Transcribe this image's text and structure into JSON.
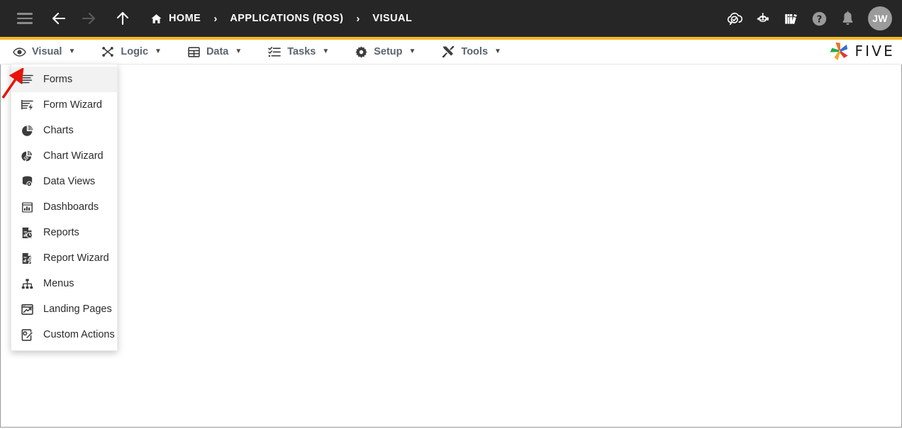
{
  "header": {
    "menu_icon": "hamburger-icon",
    "back_icon": "arrow-left-icon",
    "forward_icon": "arrow-right-icon",
    "up_icon": "arrow-up-icon",
    "breadcrumbs": [
      {
        "label": "HOME",
        "icon": "home-icon"
      },
      {
        "label": "APPLICATIONS (ROS)",
        "icon": ""
      },
      {
        "label": "VISUAL",
        "icon": ""
      }
    ],
    "separator": "›",
    "actions": [
      {
        "name": "cloud-search-icon",
        "title": ""
      },
      {
        "name": "chat-bot-icon",
        "title": ""
      },
      {
        "name": "library-books-icon",
        "title": ""
      },
      {
        "name": "help-circle-icon",
        "title": ""
      },
      {
        "name": "bell-icon",
        "title": ""
      }
    ],
    "avatar_initials": "JW",
    "accent_color": "#f5b826",
    "background_color": "#262626"
  },
  "menubar": {
    "items": [
      {
        "label": "Visual",
        "icon": "eye-icon",
        "caret": "▼",
        "open": true
      },
      {
        "label": "Logic",
        "icon": "logic-nodes-icon",
        "caret": "▼",
        "open": false
      },
      {
        "label": "Data",
        "icon": "table-grid-icon",
        "caret": "▼",
        "open": false
      },
      {
        "label": "Tasks",
        "icon": "checklist-icon",
        "caret": "▼",
        "open": false
      },
      {
        "label": "Setup",
        "icon": "gear-icon",
        "caret": "▼",
        "open": false
      },
      {
        "label": "Tools",
        "icon": "tools-wrench-screwdriver-icon",
        "caret": "▼",
        "open": false
      }
    ],
    "brand": {
      "wordmark": "FIVE",
      "logo_icon": "five-pinwheel-logo",
      "logo_colors": [
        "#2d6fd6",
        "#e03b2e",
        "#f0a81e",
        "#2aa84a"
      ]
    }
  },
  "visual_menu": {
    "items": [
      {
        "label": "Forms",
        "icon": "form-lines-icon",
        "active": true
      },
      {
        "label": "Form Wizard",
        "icon": "form-wizard-icon",
        "active": false
      },
      {
        "label": "Charts",
        "icon": "pie-chart-icon",
        "active": false
      },
      {
        "label": "Chart Wizard",
        "icon": "chart-wizard-icon",
        "active": false
      },
      {
        "label": "Data Views",
        "icon": "database-view-icon",
        "active": false
      },
      {
        "label": "Dashboards",
        "icon": "dashboard-icon",
        "active": false
      },
      {
        "label": "Reports",
        "icon": "report-icon",
        "active": false
      },
      {
        "label": "Report Wizard",
        "icon": "report-wizard-icon",
        "active": false
      },
      {
        "label": "Menus",
        "icon": "sitemap-icon",
        "active": false
      },
      {
        "label": "Landing Pages",
        "icon": "landing-page-icon",
        "active": false
      },
      {
        "label": "Custom Actions",
        "icon": "custom-action-icon",
        "active": false
      }
    ]
  },
  "annotation": {
    "arrow_color": "#e8140a",
    "points_to": "Forms"
  }
}
